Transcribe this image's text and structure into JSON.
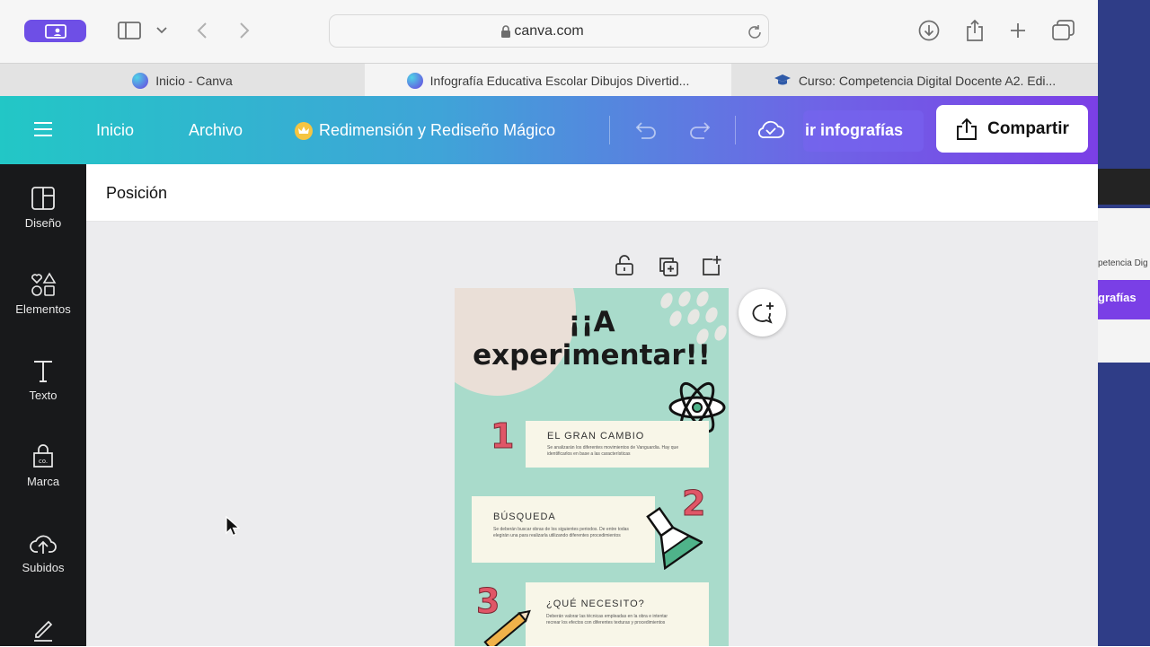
{
  "browser": {
    "url": "canva.com",
    "tabs": [
      {
        "label": "Inicio - Canva",
        "active": false
      },
      {
        "label": "Infografía Educativa Escolar Dibujos Divertid...",
        "active": true
      },
      {
        "label": "Curso: Competencia Digital Docente A2. Edi...",
        "active": false
      }
    ]
  },
  "header": {
    "home": "Inicio",
    "file": "Archivo",
    "magic": "Redimensión y Rediseño Mágico",
    "title_fragment": "ir infografías",
    "share": "Compartir"
  },
  "rail": {
    "items": [
      {
        "label": "Diseño",
        "icon": "layout-icon"
      },
      {
        "label": "Elementos",
        "icon": "shapes-icon"
      },
      {
        "label": "Texto",
        "icon": "text-icon"
      },
      {
        "label": "Marca",
        "icon": "brand-icon"
      },
      {
        "label": "Subidos",
        "icon": "upload-cloud-icon"
      }
    ]
  },
  "toolbar": {
    "position": "Posición"
  },
  "infographic": {
    "title_line1": "¡¡A",
    "title_line2": "experimentar!!",
    "steps": [
      {
        "number": "1",
        "title": "EL GRAN CAMBIO",
        "body": "Se analizarán los diferentes movimientos de Vanguardia. Hay que identificarlos en base a las características"
      },
      {
        "number": "2",
        "title": "BÚSQUEDA",
        "body": "Se deberán buscar obras de los siguientes periodos. De entre todas elegirán una para realizarla utilizando diferentes procedimientos"
      },
      {
        "number": "3",
        "title": "¿QUÉ NECESITO?",
        "body": "Deberán valorar las técnicas empleadas en la obra e intentar recrear los efectos con diferentes texturas y procedimientos"
      }
    ]
  },
  "rightwin": {
    "text1": "petencia Dig",
    "text2": "grafías"
  },
  "colors": {
    "accent": "#6e4fe6",
    "page_bg": "#a9dbcb",
    "number": "#e05667"
  }
}
